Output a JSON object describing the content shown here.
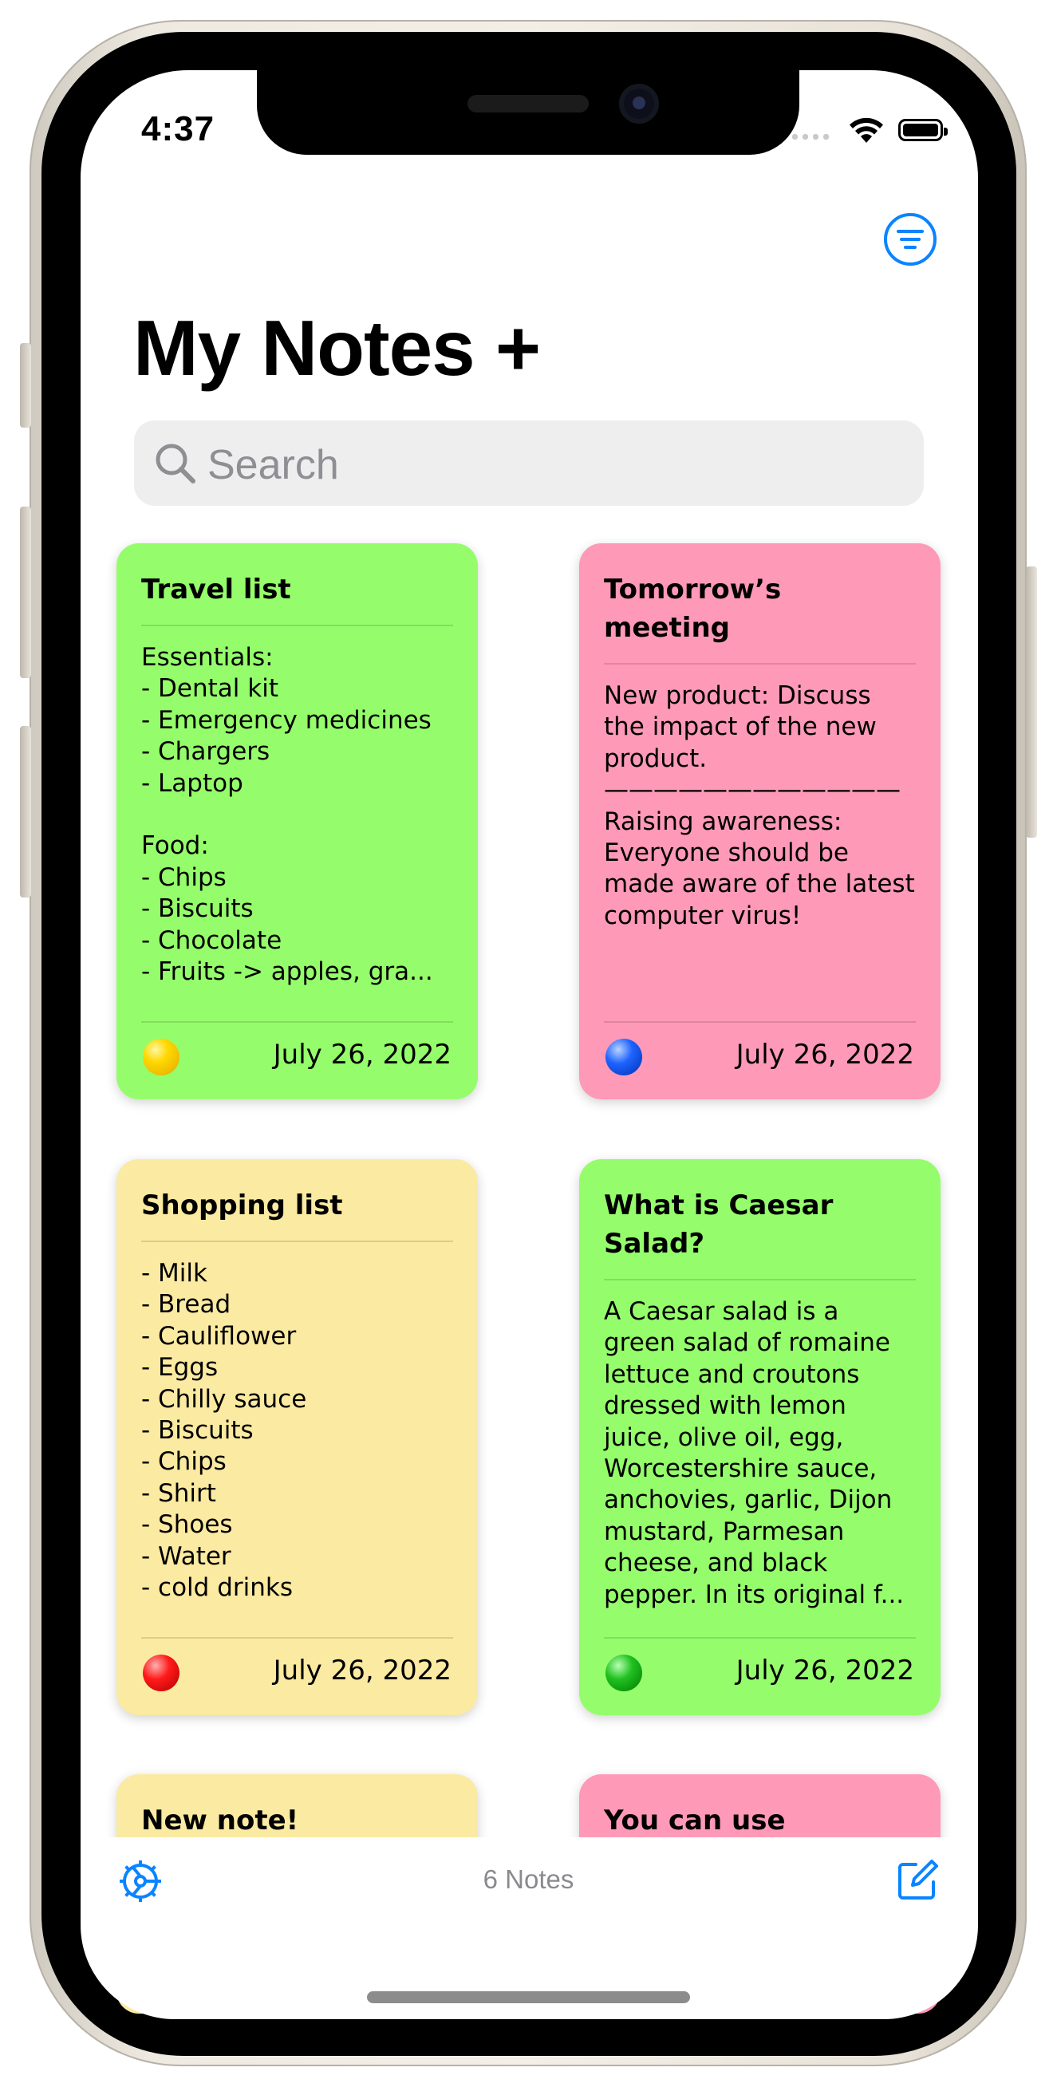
{
  "status": {
    "time": "4:37"
  },
  "header": {
    "title": "My Notes +"
  },
  "search": {
    "placeholder": "Search"
  },
  "notes": [
    {
      "title": "Travel list",
      "body": "Essentials:\n- Dental kit\n- Emergency medicines\n- Chargers\n- Laptop\n\nFood:\n- Chips\n- Biscuits\n- Chocolate\n- Fruits -> apples, gra...",
      "date": "July 26, 2022",
      "color": "#95fd6b",
      "dot": "yellow"
    },
    {
      "title": "Tomorrow’s meeting",
      "body": "New product: Discuss the impact of the new product.\n————————————\nRaising awareness: Everyone should be made aware of the latest computer virus!",
      "date": "July 26, 2022",
      "color": "#fe99b7",
      "dot": "blue"
    },
    {
      "title": "Shopping list",
      "body": "- Milk\n- Bread\n- Cauliflower\n- Eggs\n- Chilly sauce\n- Biscuits\n- Chips\n- Shirt\n- Shoes\n- Water\n- cold drinks",
      "date": "July 26, 2022",
      "color": "#fbeaa1",
      "dot": "red"
    },
    {
      "title": "What is Caesar Salad?",
      "body": "A Caesar salad is a green salad of romaine lettuce and croutons dressed with lemon juice, olive oil, egg, Worcestershire sauce, anchovies, garlic, Dijon mustard, Parmesan cheese, and black pepper. In its original f...",
      "date": "July 26, 2022",
      "color": "#95fd6b",
      "dot": "green"
    },
    {
      "title": "New note!",
      "color": "#fbeaa1"
    },
    {
      "title": "You can use",
      "color": "#fe99b7"
    }
  ],
  "footer": {
    "count": "6 Notes"
  }
}
